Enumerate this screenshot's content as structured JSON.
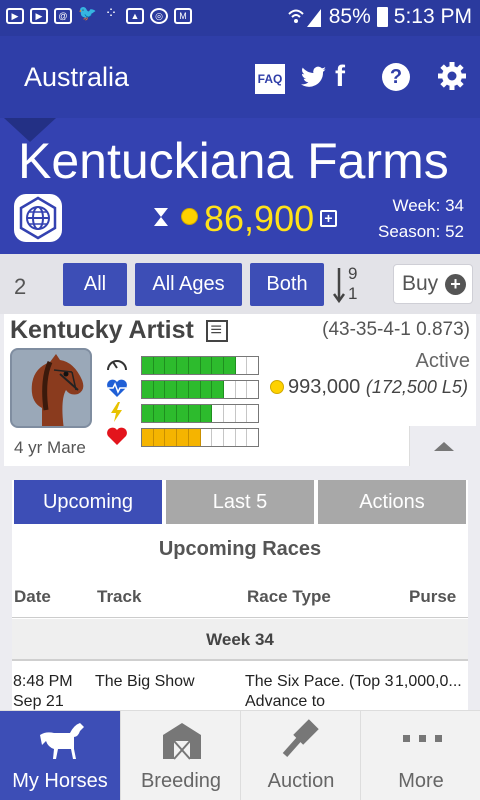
{
  "status_bar": {
    "battery": "85%",
    "time": "5:13 PM",
    "notification_icons": [
      "youtube-icon",
      "youtube-icon",
      "email-icon",
      "twitter-icon",
      "dots-icon",
      "image-icon",
      "sync-icon",
      "gmail-icon"
    ]
  },
  "app_bar": {
    "region": "Australia",
    "faq_label": "FAQ",
    "facebook_glyph": "f",
    "help_glyph": "?"
  },
  "farm": {
    "name": "Kentuckiana Farms",
    "balance": "86,900",
    "week_label": "Week: 34",
    "season_label": "Season: 52"
  },
  "filters": {
    "count": "2",
    "all_label": "All",
    "age_label": "All Ages",
    "gender_label": "Both",
    "sort_top": "9",
    "sort_bottom": "1",
    "buy_label": "Buy"
  },
  "horse": {
    "name": "Kentucky Artist",
    "record": "(43-35-4-1 0.873)",
    "age_gender": "4 yr Mare",
    "status": "Active",
    "value": "993,000",
    "lease": "(172,500 L5)",
    "stats": [
      {
        "icon": "speedometer-icon",
        "filled": 8,
        "color": "green"
      },
      {
        "icon": "heart-rate-icon",
        "filled": 7,
        "color": "green"
      },
      {
        "icon": "lightning-icon",
        "filled": 6,
        "color": "green"
      },
      {
        "icon": "heart-icon",
        "filled": 5,
        "color": "orange"
      }
    ],
    "stat_segments": 10
  },
  "tabs": {
    "upcoming": "Upcoming",
    "last5": "Last 5",
    "actions": "Actions"
  },
  "races": {
    "title": "Upcoming Races",
    "columns": [
      "Date",
      "Track",
      "Race Type",
      "Purse"
    ],
    "week_header": "Week 34",
    "rows": [
      {
        "date": "8:48 PM Sep 21",
        "track": "The Big Show",
        "type": "The Six Pace. (Top 3 Advance to",
        "purse": "1,000,0..."
      }
    ]
  },
  "nav": {
    "my_horses": "My Horses",
    "breeding": "Breeding",
    "auction": "Auction",
    "more": "More"
  },
  "colors": {
    "primary": "#2f3ea8",
    "button": "#3d4eb6",
    "balance": "#ffe21a",
    "stat_green": "#2dbb2d",
    "stat_orange": "#f5b400"
  }
}
